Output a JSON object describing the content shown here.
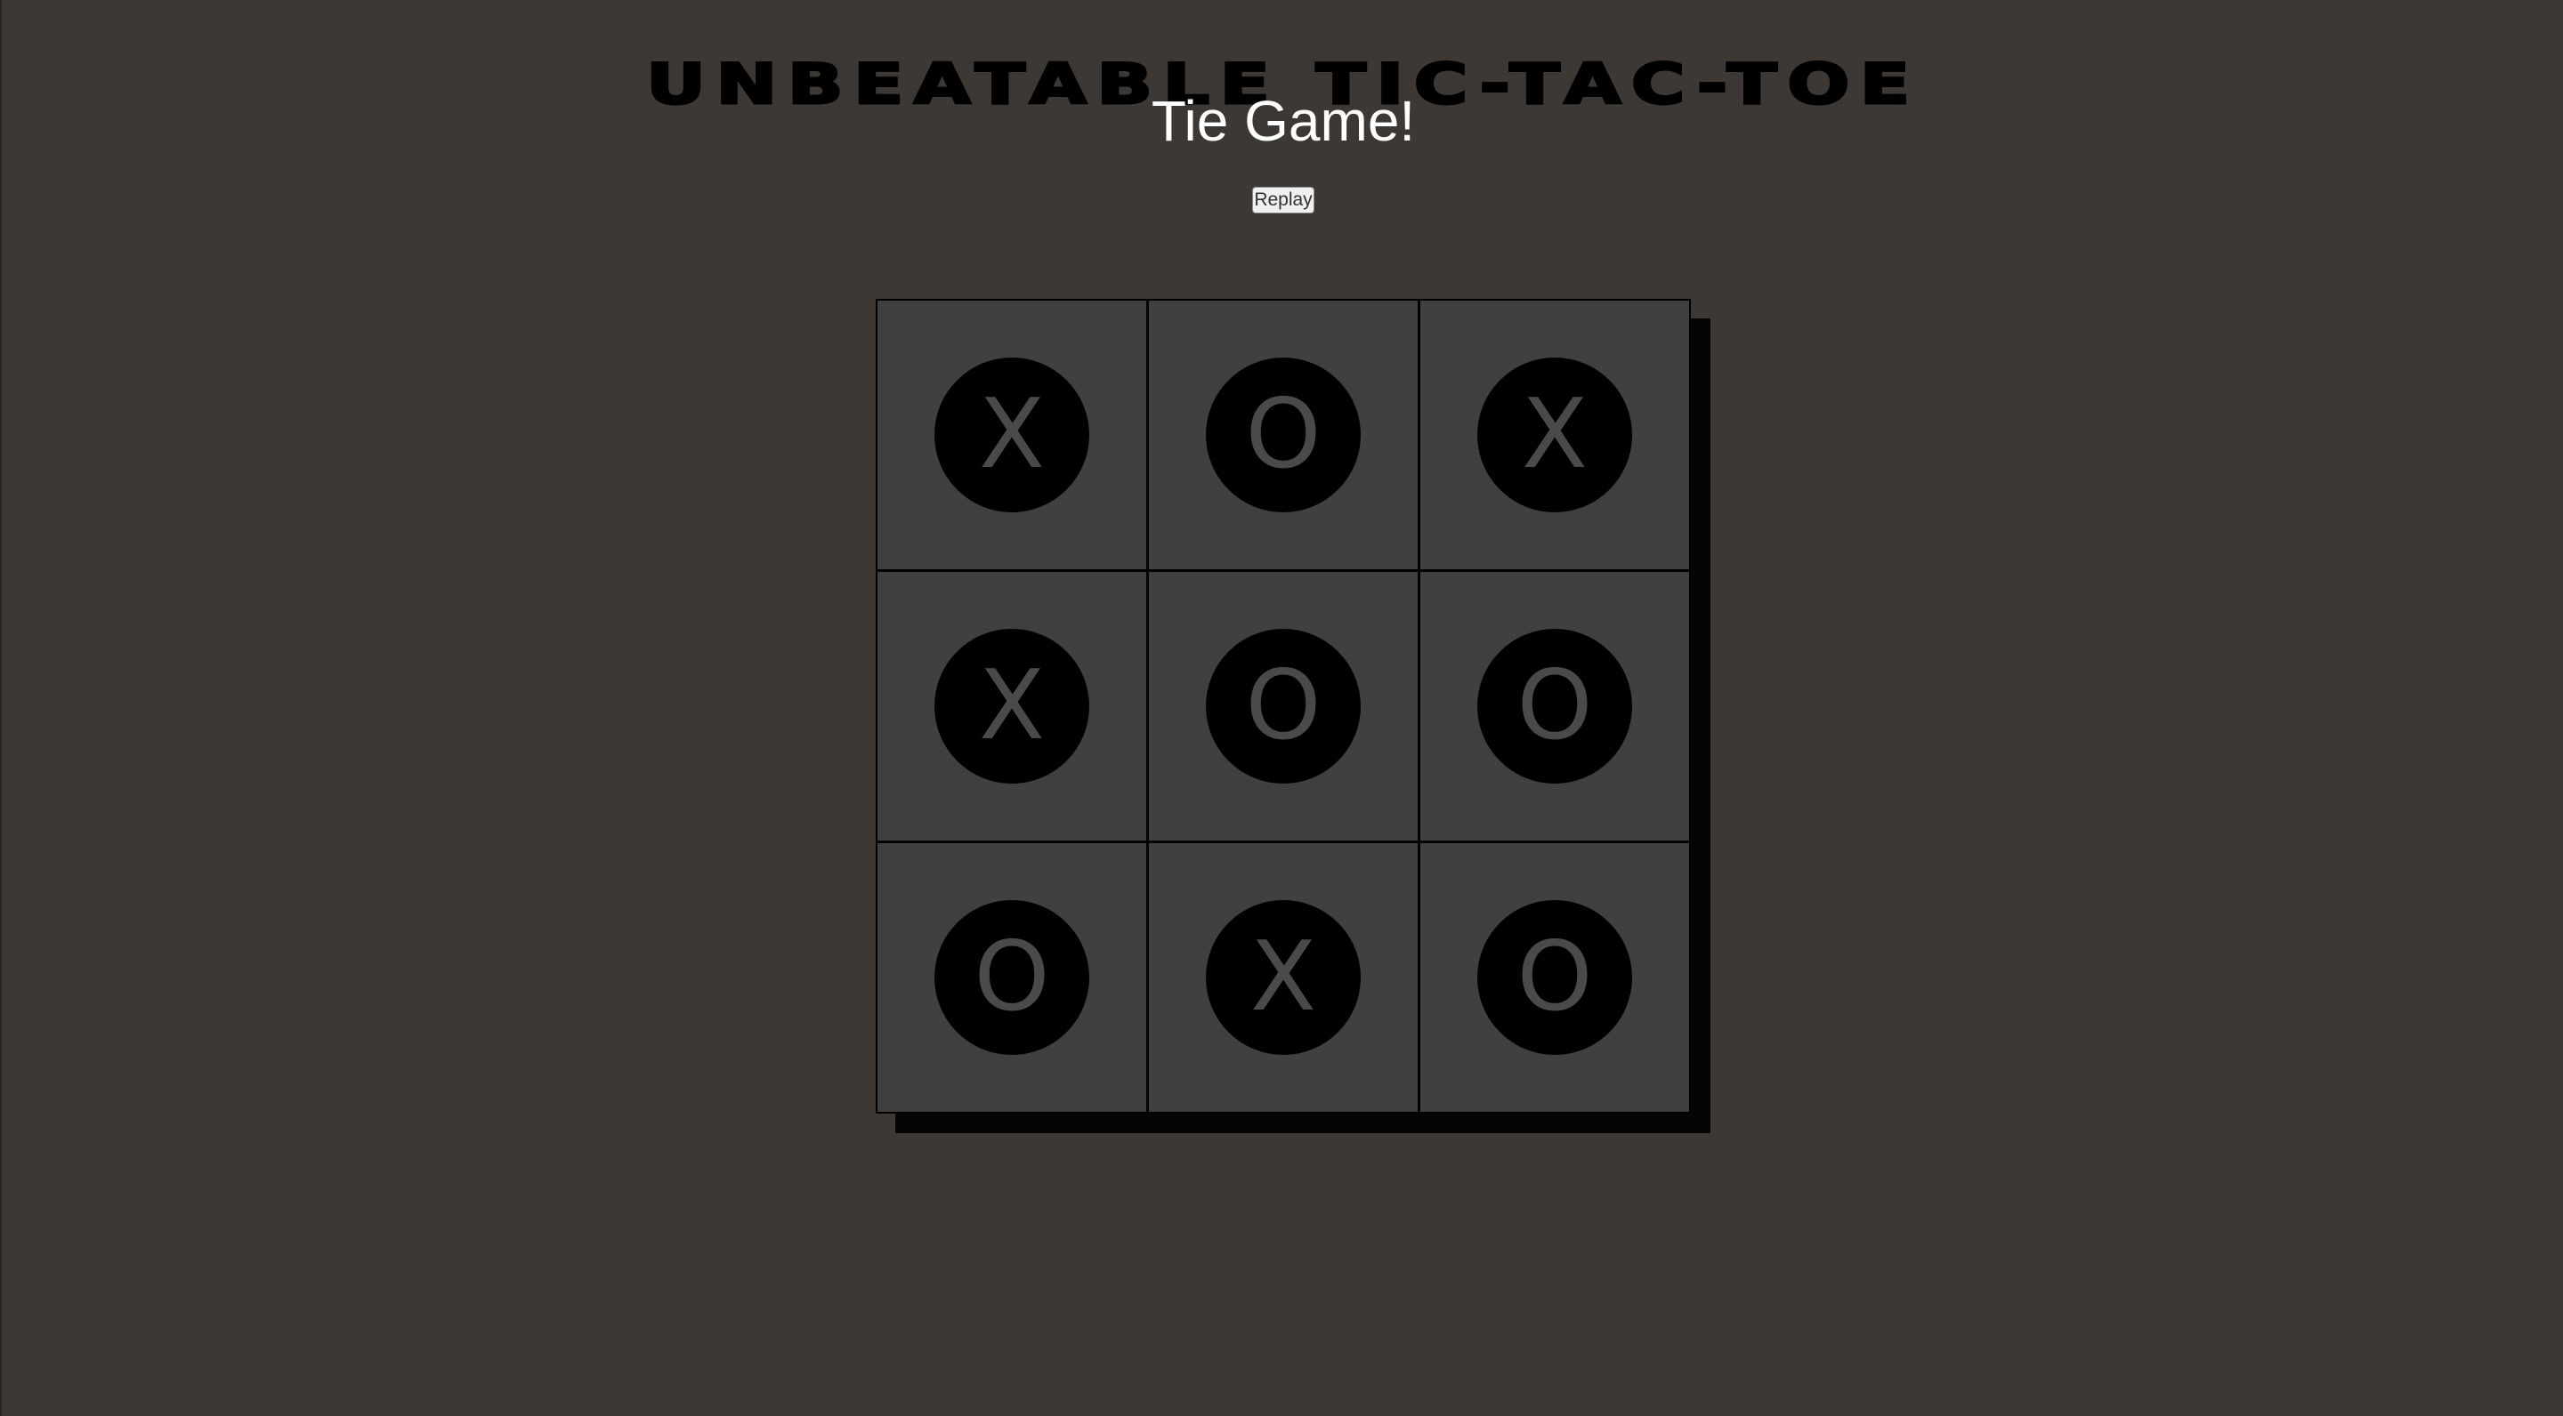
{
  "header": {
    "title": "UNBEATABLE TIC-TAC-TOE",
    "status": "Tie Game!",
    "replay_label": "Replay"
  },
  "board": {
    "cells": [
      "X",
      "O",
      "X",
      "X",
      "O",
      "O",
      "O",
      "X",
      "O"
    ]
  },
  "colors": {
    "background": "#3d3833",
    "cell": "#404040",
    "mark_circle": "#000000",
    "mark_glyph": "#4a4a4a",
    "shadow": "#050505",
    "status_text": "#ffffff"
  }
}
